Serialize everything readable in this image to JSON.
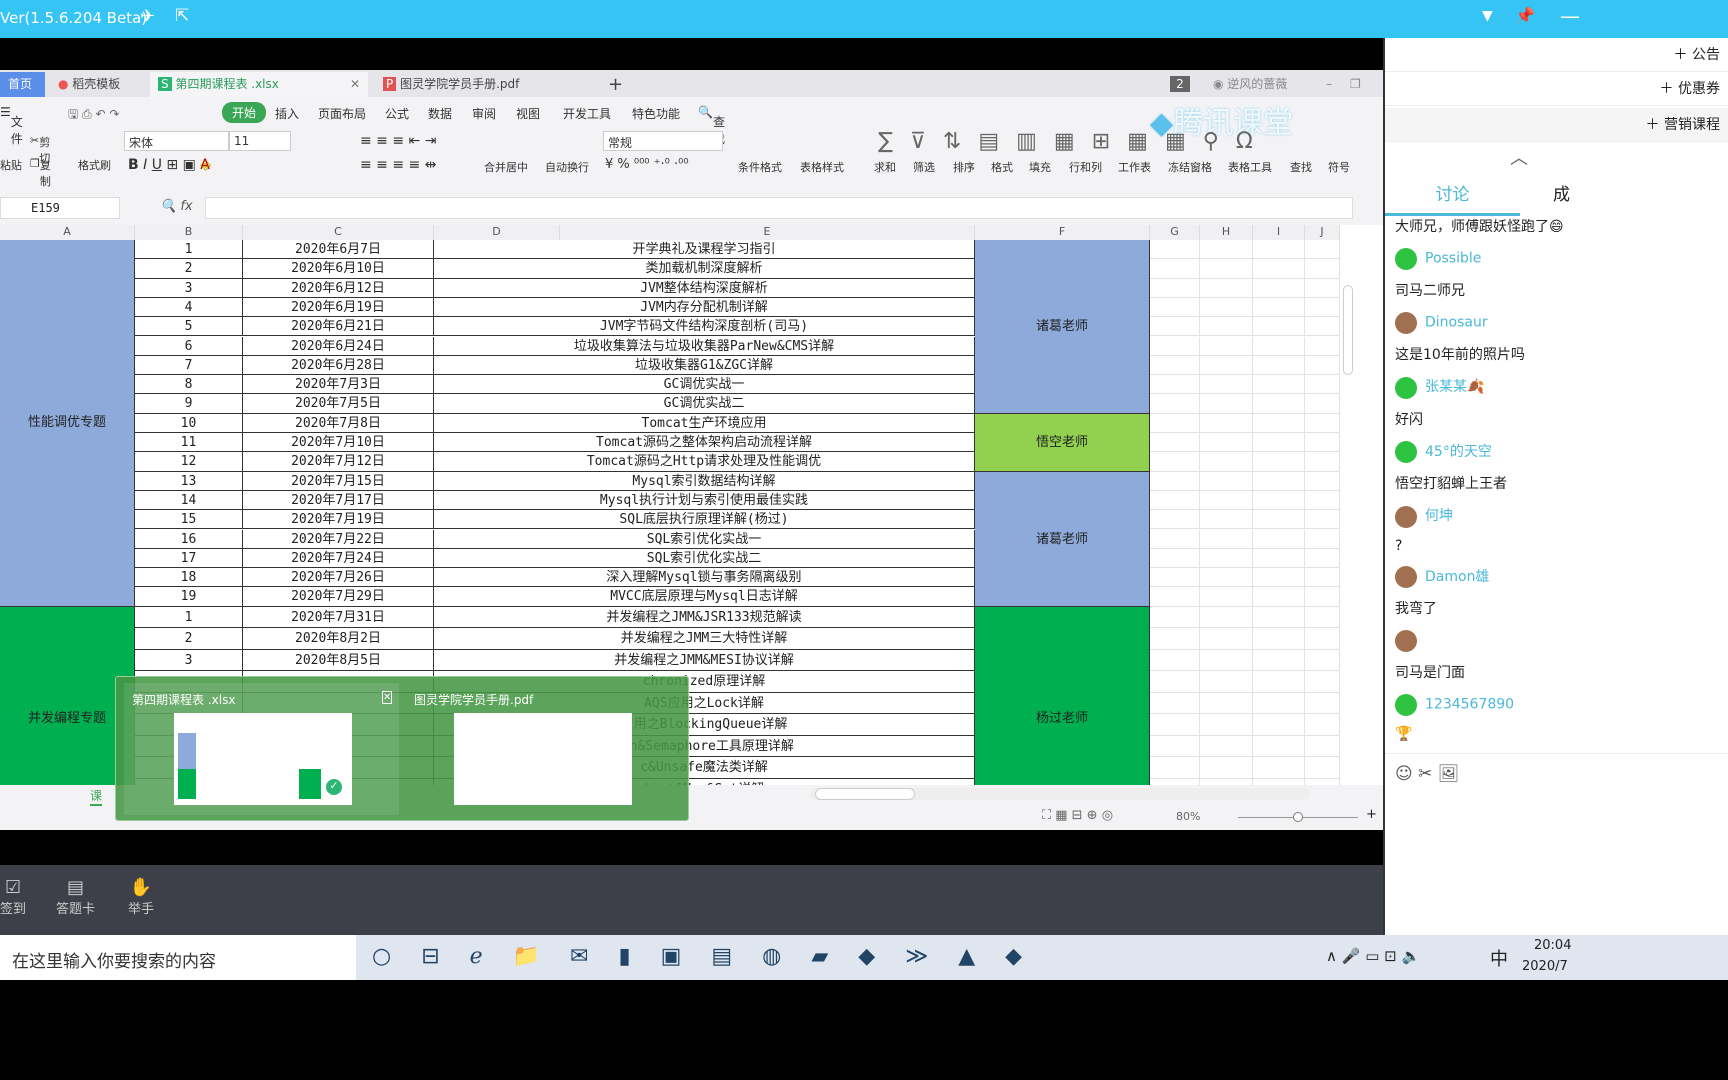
{
  "app": {
    "version": "Ver(1.5.6.204 Beta)"
  },
  "wps": {
    "tabs": [
      {
        "label": "首页"
      },
      {
        "label": "稻壳模板"
      },
      {
        "label": "第四期课程表 .xlsx"
      },
      {
        "label": "图灵学院学员手册.pdf"
      }
    ],
    "tab_count": "2",
    "user": "逆风的蔷薇",
    "menu": [
      "文件",
      "开始",
      "插入",
      "页面布局",
      "公式",
      "数据",
      "审阅",
      "视图",
      "开发工具",
      "特色功能",
      "查找"
    ],
    "ribbon": {
      "cut": "剪切",
      "copy": "复制",
      "paste": "粘贴",
      "format_painter": "格式刷",
      "font": "宋体",
      "size": "11",
      "merge": "合并居中",
      "wrap": "自动换行",
      "number_format": "常规",
      "items": [
        "条件格式",
        "表格样式",
        "求和",
        "筛选",
        "排序",
        "格式",
        "填充",
        "行和列",
        "工作表",
        "冻结窗格",
        "表格工具",
        "查找",
        "符号"
      ]
    },
    "watermark": "腾讯课堂",
    "name_box": "E159",
    "fx": "fx",
    "columns": [
      "A",
      "B",
      "C",
      "D",
      "E",
      "F",
      "G",
      "H",
      "I",
      "J"
    ],
    "groups": [
      {
        "label": "性能调优专题",
        "color": "#8eaadb"
      },
      {
        "label": "并发编程专题",
        "color": "#00b050"
      }
    ],
    "teachers": [
      {
        "label": "诸葛老师",
        "color": "#8eaadb"
      },
      {
        "label": "悟空老师",
        "color": "#92d050"
      },
      {
        "label": "诸葛老师",
        "color": "#8eaadb"
      },
      {
        "label": "杨过老师",
        "color": "#00b050"
      }
    ],
    "rows": [
      [
        "1",
        "2020年6月7日",
        "开学典礼及课程学习指引"
      ],
      [
        "2",
        "2020年6月10日",
        "类加载机制深度解析"
      ],
      [
        "3",
        "2020年6月12日",
        "JVM整体结构深度解析"
      ],
      [
        "4",
        "2020年6月19日",
        "JVM内存分配机制详解"
      ],
      [
        "5",
        "2020年6月21日",
        "JVM字节码文件结构深度剖析(司马)"
      ],
      [
        "6",
        "2020年6月24日",
        "垃圾收集算法与垃圾收集器ParNew&CMS详解"
      ],
      [
        "7",
        "2020年6月28日",
        "垃圾收集器G1&ZGC详解"
      ],
      [
        "8",
        "2020年7月3日",
        "GC调优实战一"
      ],
      [
        "9",
        "2020年7月5日",
        "GC调优实战二"
      ],
      [
        "10",
        "2020年7月8日",
        "Tomcat生产环境应用"
      ],
      [
        "11",
        "2020年7月10日",
        "Tomcat源码之整体架构启动流程详解"
      ],
      [
        "12",
        "2020年7月12日",
        "Tomcat源码之Http请求处理及性能调优"
      ],
      [
        "13",
        "2020年7月15日",
        "Mysql索引数据结构详解"
      ],
      [
        "14",
        "2020年7月17日",
        "Mysql执行计划与索引使用最佳实践"
      ],
      [
        "15",
        "2020年7月19日",
        "SQL底层执行原理详解(杨过)"
      ],
      [
        "16",
        "2020年7月22日",
        "SQL索引优化实战一"
      ],
      [
        "17",
        "2020年7月24日",
        "SQL索引优化实战二"
      ],
      [
        "18",
        "2020年7月26日",
        "深入理解Mysql锁与事务隔离级别"
      ],
      [
        "19",
        "2020年7月29日",
        "MVCC底层原理与Mysql日志详解"
      ],
      [
        "1",
        "2020年7月31日",
        "并发编程之JMM&JSR133规范解读"
      ],
      [
        "2",
        "2020年8月2日",
        "并发编程之JMM三大特性详解"
      ],
      [
        "3",
        "2020年8月5日",
        "并发编程之JMM&MESI协议详解"
      ],
      [
        "",
        "",
        "chronized原理详解"
      ],
      [
        "",
        "",
        "AQS应用之Lock详解"
      ],
      [
        "",
        "",
        "应用之BlockingQueue详解"
      ],
      [
        "",
        "",
        "tch&Semaphore工具原理详解"
      ],
      [
        "",
        "",
        "c&Unsafe魔法类详解"
      ],
      [
        "",
        "",
        "List&Map&Set详解"
      ]
    ],
    "sheet_tab": "课",
    "zoom": "80%",
    "zoom_level": 0.5
  },
  "popup": {
    "items": [
      {
        "label": "第四期课程表 .xlsx"
      },
      {
        "label": "图灵学院学员手册.pdf"
      }
    ]
  },
  "right": {
    "buttons": [
      "公告",
      "优惠券",
      "营销课程"
    ],
    "tabs": [
      "讨论",
      "成"
    ],
    "messages": [
      {
        "name": "",
        "text": "大师兄，师傅跟妖怪跑了😄",
        "avatar": "none"
      },
      {
        "name": "Possible",
        "text": "司马二师兄",
        "avatar": "wechat"
      },
      {
        "name": "Dinosaur",
        "text": "这是10年前的照片吗",
        "avatar": "photo"
      },
      {
        "name": "张某某🍂",
        "text": "好闪",
        "avatar": "wechat"
      },
      {
        "name": "45°的天空",
        "text": "悟空打貂蝉上王者",
        "avatar": "wechat"
      },
      {
        "name": "何坤",
        "text": "?",
        "avatar": "photo"
      },
      {
        "name": "Damon雄",
        "text": "我弯了",
        "avatar": "photo"
      },
      {
        "name": "",
        "text": "司马是门面",
        "avatar": "photo"
      },
      {
        "name": "1234567890",
        "text": "🏆",
        "avatar": "wechat"
      }
    ]
  },
  "bottom": {
    "actions": [
      "签到",
      "答题卡",
      "举手"
    ]
  },
  "taskbar": {
    "search_placeholder": "在这里输入你要搜索的内容",
    "ime": "中",
    "time": "20:04",
    "date": "2020/7"
  }
}
